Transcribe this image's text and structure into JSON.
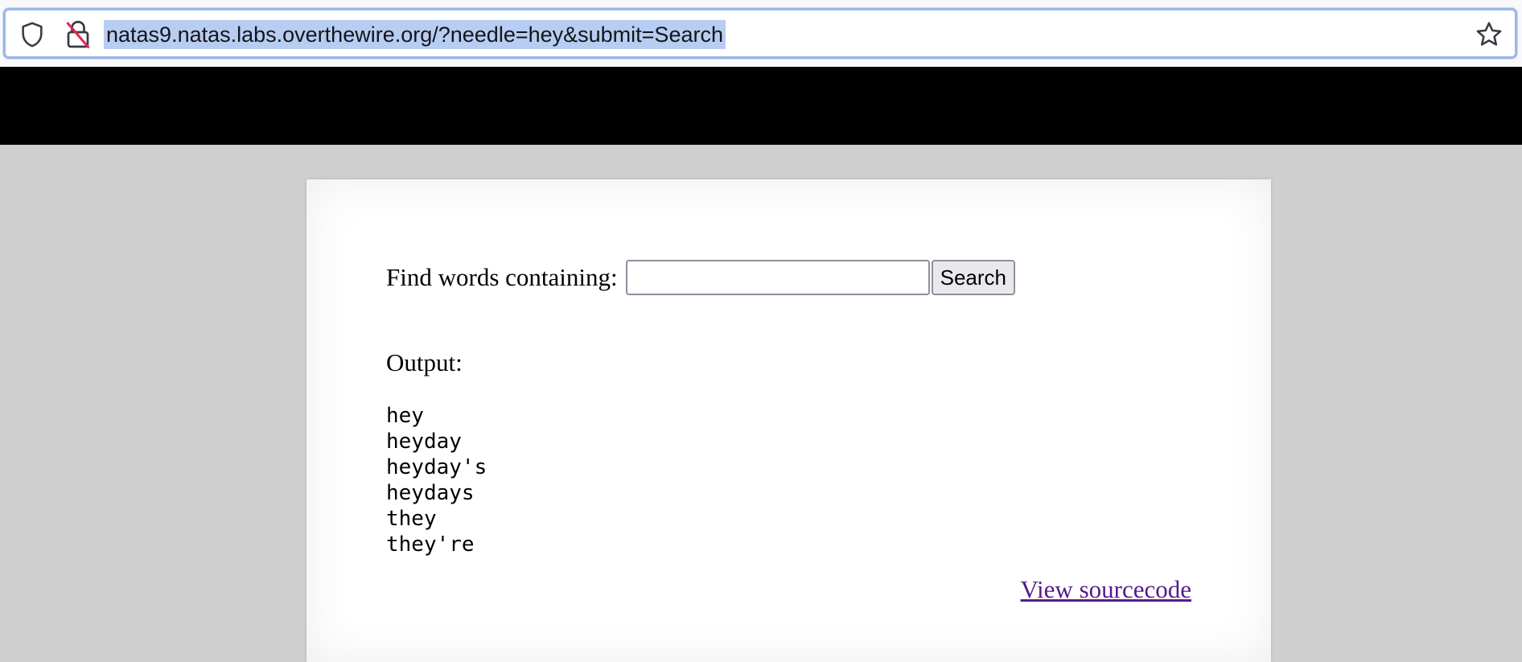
{
  "browser": {
    "url": "natas9.natas.labs.overthewire.org/?needle=hey&submit=Search",
    "icons": {
      "shield": "shield-icon",
      "lock": "insecure-lock-icon",
      "bookmark": "star-icon"
    },
    "url_selection_color": "#b7cdf2"
  },
  "form": {
    "label": "Find words containing:",
    "input_value": "",
    "button_label": "Search"
  },
  "output": {
    "label": "Output:",
    "results": [
      "hey",
      "heyday",
      "heyday's",
      "heydays",
      "they",
      "they're"
    ]
  },
  "footer": {
    "source_link": "View sourcecode"
  },
  "colors": {
    "header": "#000000",
    "page_bg": "#cfcfcf",
    "link_visited": "#551a8b"
  }
}
